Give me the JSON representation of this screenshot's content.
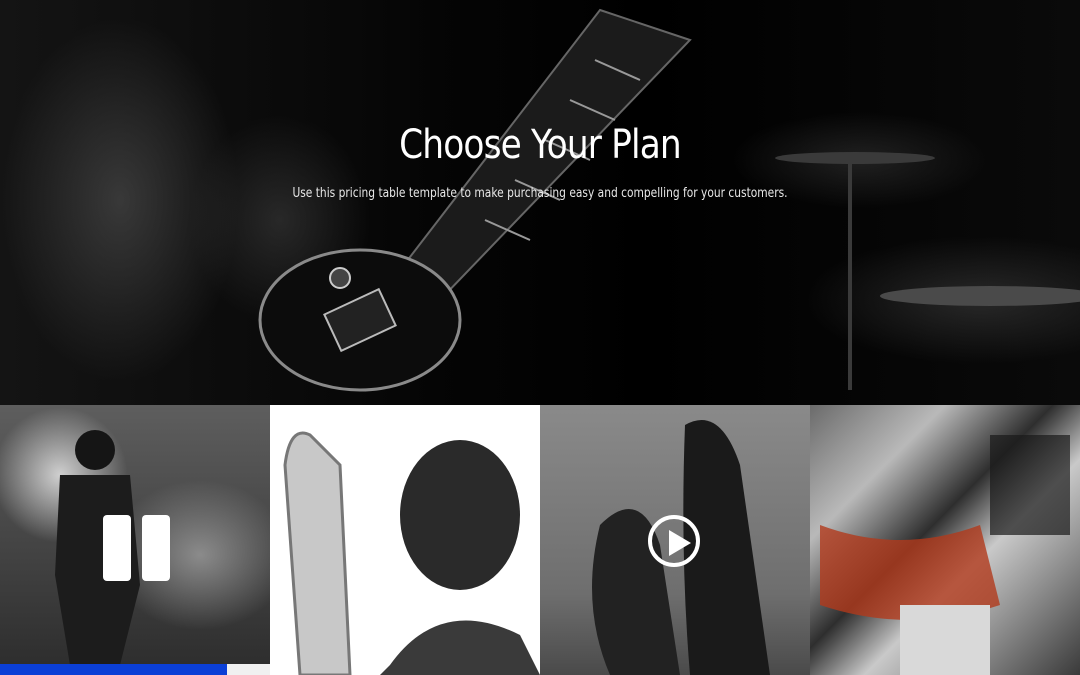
{
  "hero": {
    "title": "Choose Your Plan",
    "subtitle": "Use this pricing table template to make purchasing easy and compelling for your customers."
  },
  "tiles": [
    {
      "name": "smoke-guitarist",
      "overlay": "pause-icon"
    },
    {
      "name": "saxophonist",
      "overlay": ""
    },
    {
      "name": "feet",
      "overlay": "play-icon"
    },
    {
      "name": "poster-wall",
      "overlay": ""
    }
  ],
  "progress": {
    "value": 0.84,
    "color": "#0b3fd6"
  }
}
